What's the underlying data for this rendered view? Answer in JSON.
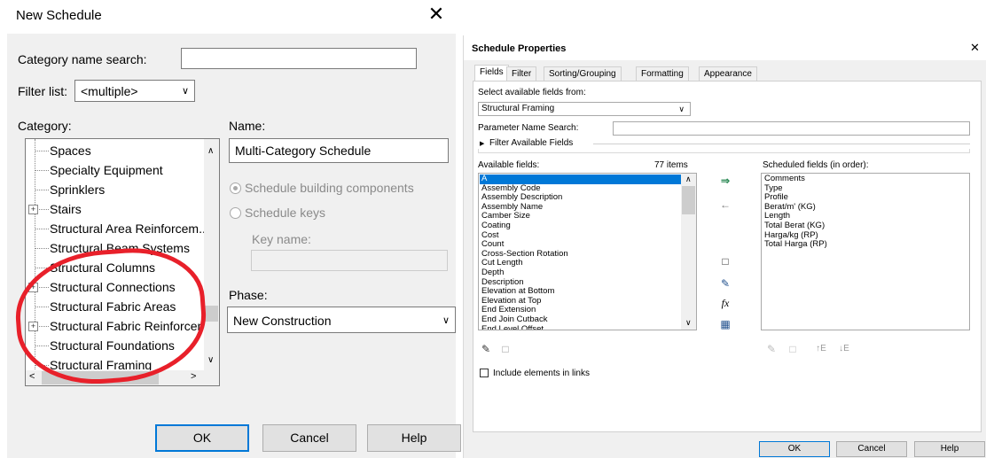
{
  "new_schedule": {
    "title": "New Schedule",
    "close_glyph": "✕",
    "category_search_label": "Category name search:",
    "category_search_value": "",
    "filter_label": "Filter list:",
    "filter_value": "<multiple>",
    "category_label": "Category:",
    "categories": [
      {
        "label": "Spaces",
        "expandable": false
      },
      {
        "label": "Specialty Equipment",
        "expandable": false
      },
      {
        "label": "Sprinklers",
        "expandable": false
      },
      {
        "label": "Stairs",
        "expandable": true
      },
      {
        "label": "Structural Area Reinforcem...",
        "expandable": false
      },
      {
        "label": "Structural Beam Systems",
        "expandable": false
      },
      {
        "label": "Structural Columns",
        "expandable": false
      },
      {
        "label": "Structural Connections",
        "expandable": true
      },
      {
        "label": "Structural Fabric Areas",
        "expandable": false
      },
      {
        "label": "Structural Fabric Reinforcem...",
        "expandable": true
      },
      {
        "label": "Structural Foundations",
        "expandable": false
      },
      {
        "label": "Structural Framing",
        "expandable": false
      }
    ],
    "name_label": "Name:",
    "name_value": "Multi-Category Schedule",
    "radio_components": "Schedule building components",
    "radio_keys": "Schedule keys",
    "key_name_label": "Key name:",
    "key_name_value": "",
    "phase_label": "Phase:",
    "phase_value": "New Construction",
    "ok_label": "OK",
    "cancel_label": "Cancel",
    "help_label": "Help",
    "annotation_color": "#e8202a"
  },
  "schedule_properties": {
    "title": "Schedule Properties",
    "close_glyph": "✕",
    "tabs": [
      "Fields",
      "Filter",
      "Sorting/Grouping",
      "Formatting",
      "Appearance"
    ],
    "select_fields_label": "Select available fields from:",
    "select_fields_value": "Structural Framing",
    "param_search_label": "Parameter Name Search:",
    "param_search_value": "",
    "filter_fields_label": "Filter Available Fields",
    "available_label": "Available fields:",
    "available_count": "77 items",
    "available_fields": [
      "A",
      "Assembly Code",
      "Assembly Description",
      "Assembly Name",
      "Camber Size",
      "Coating",
      "Cost",
      "Count",
      "Cross-Section Rotation",
      "Cut Length",
      "Depth",
      "Description",
      "Elevation at Bottom",
      "Elevation at Top",
      "End Extension",
      "End Join Cutback",
      "End Level Offset"
    ],
    "scheduled_label": "Scheduled fields (in order):",
    "scheduled_fields": [
      "Comments",
      "Type",
      "Profile",
      "Berat/m' (KG)",
      "Length",
      "Total Berat (KG)",
      "Harga/kg (RP)",
      "Total Harga (RP)"
    ],
    "include_links_label": "Include elements in links",
    "sort_up_label": "↑E",
    "sort_down_label": "↓E",
    "fx_label": "fx",
    "ok_label": "OK",
    "cancel_label": "Cancel",
    "help_label": "Help",
    "selection_color": "#0078d7"
  }
}
